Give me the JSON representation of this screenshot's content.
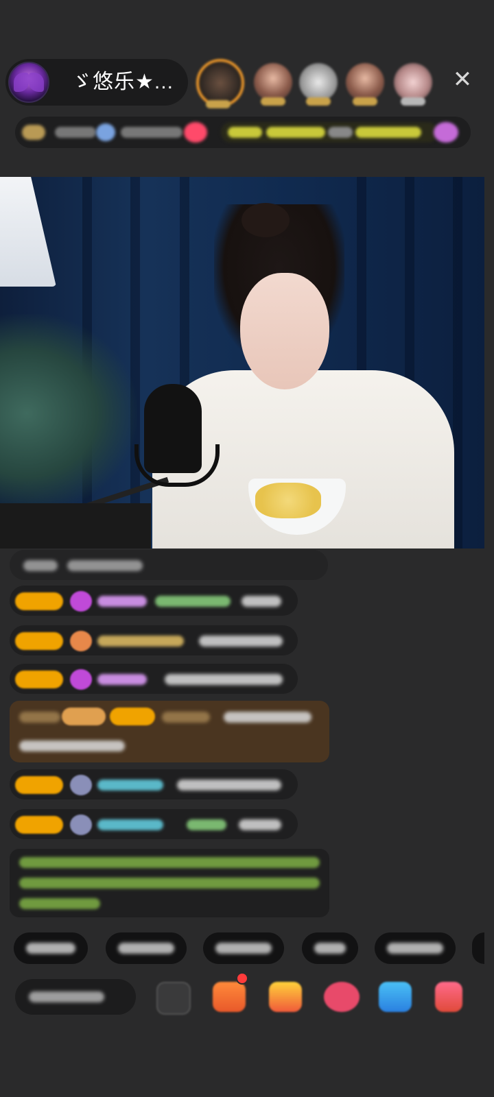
{
  "header": {
    "host_name": "ゞ悠乐★...",
    "close_icon": "close-icon",
    "viewer_avatar_count": 5
  },
  "colors": {
    "background": "#2a2a2b",
    "badge_gold": "#f0a300",
    "gift_row_bg": "#4a3520",
    "notice_text": "#8bc34a",
    "unread_dot": "#ff3b3b"
  },
  "chat": {
    "rows": [
      {
        "type": "message"
      },
      {
        "type": "message"
      },
      {
        "type": "message"
      },
      {
        "type": "message"
      },
      {
        "type": "gift"
      },
      {
        "type": "message"
      },
      {
        "type": "message"
      },
      {
        "type": "notice"
      }
    ]
  },
  "quick_replies_count": 6,
  "bottom_bar": {
    "icons": [
      "emoji-icon",
      "gift-box-icon",
      "gift-icon",
      "heart-icon",
      "chat-bubble-icon",
      "more-icon"
    ]
  }
}
